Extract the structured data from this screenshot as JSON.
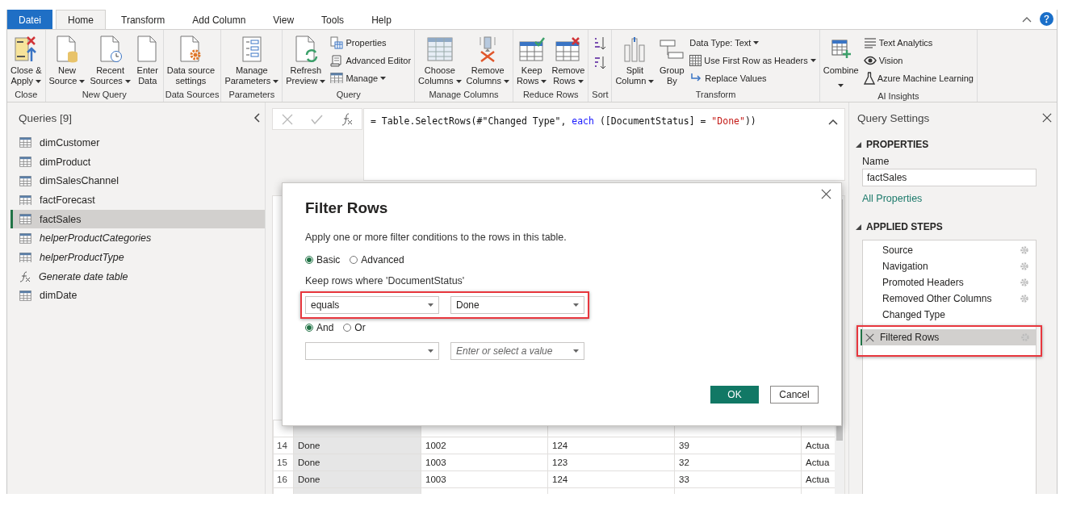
{
  "ribbon_tabs": [
    {
      "label": "Datei",
      "kind": "file",
      "selected": false
    },
    {
      "label": "Home",
      "kind": "tab",
      "selected": true
    },
    {
      "label": "Transform",
      "kind": "tab",
      "selected": false
    },
    {
      "label": "Add Column",
      "kind": "tab",
      "selected": false
    },
    {
      "label": "View",
      "kind": "tab",
      "selected": false
    },
    {
      "label": "Tools",
      "kind": "tab",
      "selected": false
    },
    {
      "label": "Help",
      "kind": "tab",
      "selected": false
    }
  ],
  "ribbon_groups": [
    {
      "label": "Close",
      "buttons": [
        {
          "kind": "large",
          "lines": [
            "Close &",
            "Apply"
          ],
          "dropdown": true
        }
      ]
    },
    {
      "label": "New Query",
      "buttons": [
        {
          "kind": "large",
          "lines": [
            "New",
            "Source"
          ],
          "dropdown": true
        },
        {
          "kind": "large",
          "lines": [
            "Recent",
            "Sources"
          ],
          "dropdown": true
        },
        {
          "kind": "large",
          "lines": [
            "Enter",
            "Data"
          ],
          "dropdown": false
        }
      ]
    },
    {
      "label": "Data Sources",
      "buttons": [
        {
          "kind": "large",
          "lines": [
            "Data source",
            "settings"
          ],
          "dropdown": false
        }
      ]
    },
    {
      "label": "Parameters",
      "buttons": [
        {
          "kind": "large",
          "lines": [
            "Manage",
            "Parameters"
          ],
          "dropdown": true
        }
      ]
    },
    {
      "label": "Query",
      "buttons": [
        {
          "kind": "large",
          "lines": [
            "Refresh",
            "Preview"
          ],
          "dropdown": true
        },
        {
          "kind": "stack",
          "items": [
            {
              "label": "Properties",
              "dropdown": false
            },
            {
              "label": "Advanced Editor",
              "dropdown": false
            },
            {
              "label": "Manage",
              "dropdown": true
            }
          ]
        }
      ]
    },
    {
      "label": "Manage Columns",
      "buttons": [
        {
          "kind": "large",
          "lines": [
            "Choose",
            "Columns"
          ],
          "dropdown": true
        },
        {
          "kind": "large",
          "lines": [
            "Remove",
            "Columns"
          ],
          "dropdown": true
        }
      ]
    },
    {
      "label": "Reduce Rows",
      "buttons": [
        {
          "kind": "large",
          "lines": [
            "Keep",
            "Rows"
          ],
          "dropdown": true
        },
        {
          "kind": "large",
          "lines": [
            "Remove",
            "Rows"
          ],
          "dropdown": true
        }
      ]
    },
    {
      "label": "Sort",
      "buttons": [
        {
          "kind": "sort"
        }
      ]
    },
    {
      "label": "Transform",
      "buttons": [
        {
          "kind": "large",
          "lines": [
            "Split",
            "Column"
          ],
          "dropdown": true
        },
        {
          "kind": "large",
          "lines": [
            "Group",
            "By"
          ],
          "dropdown": false
        },
        {
          "kind": "stack",
          "items": [
            {
              "label": "Data Type: Text",
              "dropdown": true
            },
            {
              "label": "Use First Row as Headers",
              "dropdown": true
            },
            {
              "label": "Replace Values",
              "dropdown": false
            }
          ]
        }
      ]
    },
    {
      "label": "AI Insights",
      "buttons": [
        {
          "kind": "large",
          "lines": [
            "Combine"
          ],
          "dropdown": true
        },
        {
          "kind": "stack",
          "items": [
            {
              "label": "Text Analytics",
              "dropdown": false
            },
            {
              "label": "Vision",
              "dropdown": false
            },
            {
              "label": "Azure Machine Learning",
              "dropdown": false
            }
          ]
        }
      ]
    }
  ],
  "queries": {
    "title": "Queries [9]",
    "items": [
      {
        "name": "dimCustomer",
        "kind": "table",
        "italic": false,
        "selected": false
      },
      {
        "name": "dimProduct",
        "kind": "table",
        "italic": false,
        "selected": false
      },
      {
        "name": "dimSalesChannel",
        "kind": "table",
        "italic": false,
        "selected": false
      },
      {
        "name": "factForecast",
        "kind": "table",
        "italic": false,
        "selected": false
      },
      {
        "name": "factSales",
        "kind": "table",
        "italic": false,
        "selected": true
      },
      {
        "name": "helperProductCategories",
        "kind": "table",
        "italic": true,
        "selected": false
      },
      {
        "name": "helperProductType",
        "kind": "table",
        "italic": true,
        "selected": false
      },
      {
        "name": "Generate date table",
        "kind": "function",
        "italic": true,
        "selected": false
      },
      {
        "name": "dimDate",
        "kind": "table",
        "italic": false,
        "selected": false
      }
    ]
  },
  "formula": {
    "tokens": [
      {
        "text": "= Table.SelectRows(#\"Changed Type\", ",
        "kind": "plain"
      },
      {
        "text": "each",
        "kind": "keyword"
      },
      {
        "text": " ([DocumentStatus] = ",
        "kind": "plain"
      },
      {
        "text": "\"Done\"",
        "kind": "string"
      },
      {
        "text": "))",
        "kind": "plain"
      }
    ]
  },
  "table": {
    "columns": [
      {
        "selected": true
      },
      {
        "selected": false
      },
      {
        "selected": false
      },
      {
        "selected": false
      },
      {
        "selected": false
      }
    ],
    "rows": [
      {
        "number": "14",
        "cells": [
          "Done",
          "1002",
          "124",
          "39",
          "Actua"
        ]
      },
      {
        "number": "15",
        "cells": [
          "Done",
          "1003",
          "123",
          "32",
          "Actua"
        ]
      },
      {
        "number": "16",
        "cells": [
          "Done",
          "1003",
          "124",
          "33",
          "Actua"
        ]
      }
    ]
  },
  "dialog": {
    "title": "Filter Rows",
    "description": "Apply one or more filter conditions to the rows in this table.",
    "modes": [
      {
        "label": "Basic",
        "selected": true
      },
      {
        "label": "Advanced",
        "selected": false
      }
    ],
    "condition_label": "Keep rows where 'DocumentStatus'",
    "conditions": [
      {
        "operator": "equals",
        "value": "Done",
        "highlighted": true
      },
      {
        "value_placeholder": "Enter or select a value",
        "highlighted": false
      }
    ],
    "joiners": [
      {
        "label": "And",
        "selected": true
      },
      {
        "label": "Or",
        "selected": false
      }
    ],
    "buttons": [
      {
        "label": "OK",
        "kind": "primary"
      },
      {
        "label": "Cancel",
        "kind": "secondary"
      }
    ]
  },
  "query_settings": {
    "title": "Query Settings",
    "properties_heading": "PROPERTIES",
    "name_label": "Name",
    "name_value": "factSales",
    "all_properties_link": "All Properties",
    "steps_heading": "APPLIED STEPS",
    "steps": [
      {
        "name": "Source",
        "settings": true,
        "selected": false,
        "highlighted": false
      },
      {
        "name": "Navigation",
        "settings": true,
        "selected": false,
        "highlighted": false
      },
      {
        "name": "Promoted Headers",
        "settings": true,
        "selected": false,
        "highlighted": false
      },
      {
        "name": "Removed Other Columns",
        "settings": true,
        "selected": false,
        "highlighted": false
      },
      {
        "name": "Changed Type",
        "settings": false,
        "selected": false,
        "highlighted": false
      },
      {
        "name": "Filtered Rows",
        "settings": true,
        "selected": true,
        "highlighted": true
      }
    ]
  }
}
